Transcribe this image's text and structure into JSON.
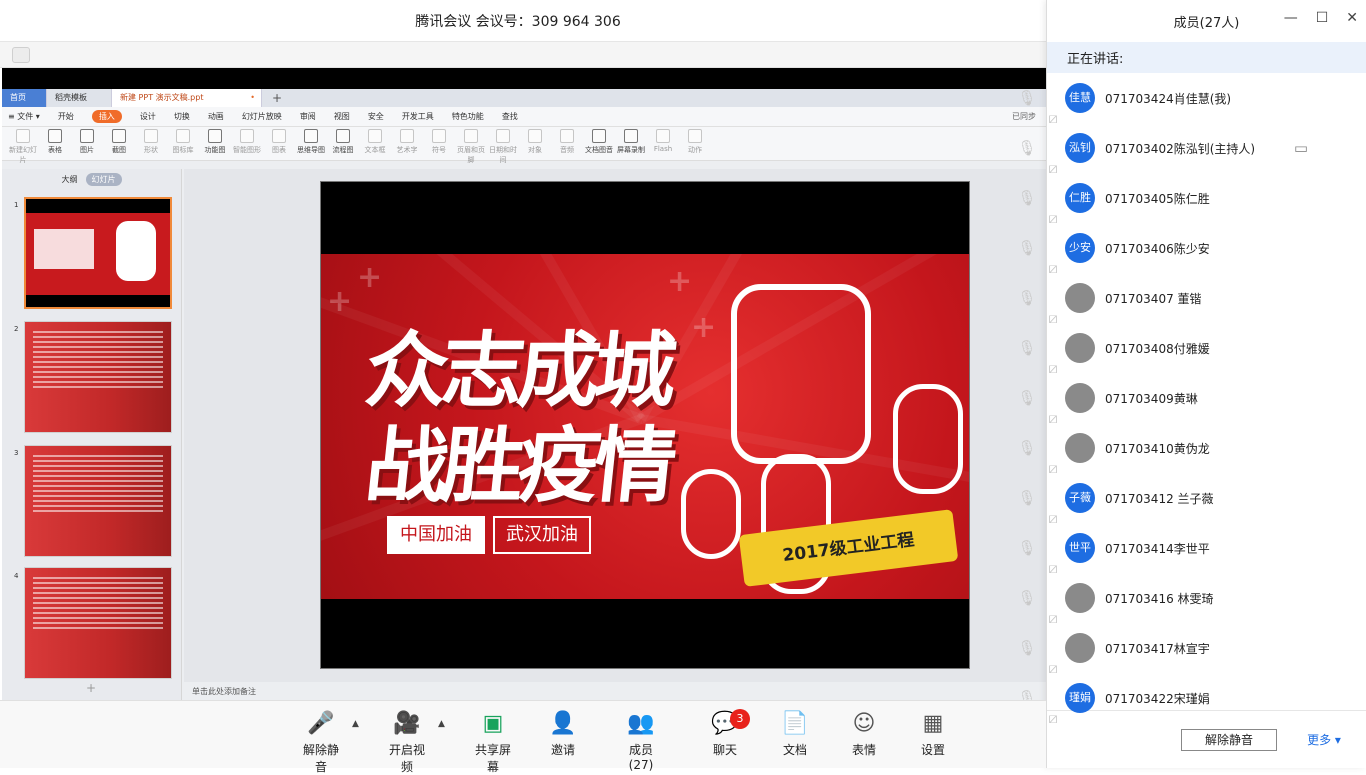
{
  "window": {
    "title": "腾讯会议 会议号：309 964 306"
  },
  "wps": {
    "tabs": [
      {
        "label": "首页"
      },
      {
        "label": "稻壳模板"
      },
      {
        "label": "新建 PPT 演示文稿.ppt"
      }
    ],
    "add_tab": "+",
    "menu": [
      {
        "label": "≡ 文件 ▾"
      },
      {
        "label": "开始"
      },
      {
        "label": "插入"
      },
      {
        "label": "设计"
      },
      {
        "label": "切换"
      },
      {
        "label": "动画"
      },
      {
        "label": "幻灯片放映"
      },
      {
        "label": "审阅"
      },
      {
        "label": "视图"
      },
      {
        "label": "安全"
      },
      {
        "label": "开发工具"
      },
      {
        "label": "特色功能"
      },
      {
        "label": "查找"
      }
    ],
    "sync_status": "已同步",
    "ribbon": [
      {
        "label": "新建幻灯片"
      },
      {
        "label": "表格"
      },
      {
        "label": "图片"
      },
      {
        "label": "截图"
      },
      {
        "label": "形状"
      },
      {
        "label": "图标库"
      },
      {
        "label": "功能图"
      },
      {
        "label": "智能图形"
      },
      {
        "label": "图表"
      },
      {
        "label": "思维导图"
      },
      {
        "label": "流程图"
      },
      {
        "label": "文本框"
      },
      {
        "label": "艺术字"
      },
      {
        "label": "符号"
      },
      {
        "label": "页眉和页脚"
      },
      {
        "label": "日期和时间"
      },
      {
        "label": "对象"
      },
      {
        "label": "音频"
      },
      {
        "label": "文档图音"
      },
      {
        "label": "屏幕录制"
      },
      {
        "label": "Flash"
      },
      {
        "label": "动作"
      }
    ],
    "panel_tabs": {
      "outline": "大纲",
      "slides": "幻灯片"
    },
    "slide_numbers": [
      "1",
      "2",
      "3",
      "4"
    ],
    "add_slide": "+",
    "notes_placeholder": "单击此处添加备注",
    "slide": {
      "title_line1": "众志成城",
      "title_line2": "战胜疫情",
      "tag1": "中国加油",
      "tag2": "武汉加油",
      "banner": "2017级工业工程"
    }
  },
  "members_panel": {
    "title": "成员(27人)",
    "speaking_label": "正在讲话:",
    "members": [
      {
        "avatar": "佳慧",
        "name": "071703424肖佳慧(我)"
      },
      {
        "avatar": "泓钊",
        "name": "071703402陈泓钊(主持人)"
      },
      {
        "avatar": "仁胜",
        "name": "071703405陈仁胜"
      },
      {
        "avatar": "少安",
        "name": "071703406陈少安"
      },
      {
        "avatar": "",
        "name": "071703407 董锴"
      },
      {
        "avatar": "",
        "name": "071703408付雅媛"
      },
      {
        "avatar": "",
        "name": "071703409黄琳"
      },
      {
        "avatar": "",
        "name": "071703410黄伪龙"
      },
      {
        "avatar": "子薇",
        "name": "071703412 兰子薇"
      },
      {
        "avatar": "世平",
        "name": "071703414李世平"
      },
      {
        "avatar": "",
        "name": "071703416 林雯琦"
      },
      {
        "avatar": "",
        "name": "071703417林宣宇"
      },
      {
        "avatar": "瑾娟",
        "name": "071703422宋瑾娟"
      }
    ],
    "unmute_all": "解除静音",
    "more": "更多 ▾"
  },
  "toolbar": {
    "unmute": "解除静音",
    "video": "开启视频",
    "share": "共享屏幕",
    "invite": "邀请",
    "members": "成员(27)",
    "chat": "聊天",
    "chat_badge": "3",
    "docs": "文档",
    "emoji": "表情",
    "settings": "设置"
  }
}
